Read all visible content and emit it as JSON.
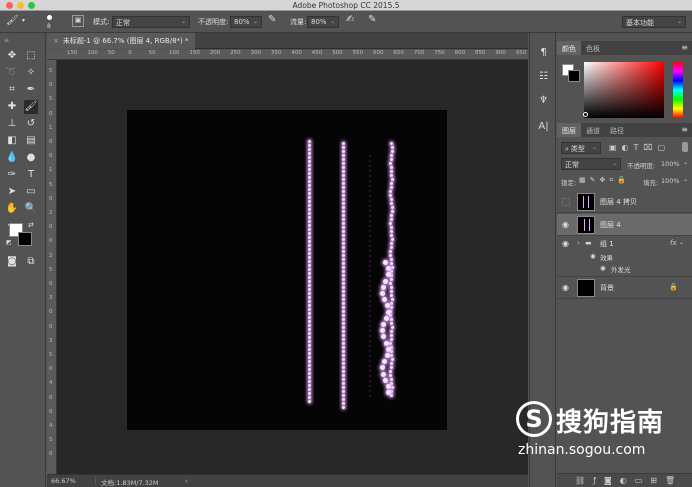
{
  "titlebar": {
    "title": "Adobe Photoshop CC 2015.5"
  },
  "options": {
    "brush_size": "8",
    "mode_label": "模式:",
    "mode_value": "正常",
    "opacity_label": "不透明度:",
    "opacity_value": "80%",
    "flow_label": "流量:",
    "flow_value": "80%",
    "workspace_value": "基本功能"
  },
  "document": {
    "tab_label": "未标题-1 @ 66.7% (图层 4, RGB/8*) *",
    "ruler_h": [
      "150",
      "100",
      "50",
      "0",
      "50",
      "100",
      "150",
      "200",
      "250",
      "300",
      "350",
      "400",
      "450",
      "500",
      "550",
      "600",
      "650",
      "700",
      "750",
      "800",
      "850",
      "900",
      "950"
    ],
    "ruler_v": [
      "5",
      "0",
      "5",
      "0",
      "1",
      "0",
      "0",
      "1",
      "5",
      "0",
      "2",
      "0",
      "0",
      "2",
      "5",
      "0",
      "3",
      "0",
      "0",
      "3",
      "5",
      "0",
      "4",
      "0",
      "0",
      "4",
      "5",
      "0"
    ]
  },
  "status": {
    "zoom": "66.67%",
    "doc_info": "文档:1.83M/7.32M"
  },
  "color_panel": {
    "tabs": [
      "颜色",
      "色板"
    ]
  },
  "layers_panel": {
    "tabs": [
      "图层",
      "通道",
      "路径"
    ],
    "filter_label": "类型",
    "blend_mode": "正常",
    "opacity_label": "不透明度:",
    "opacity_value": "100%",
    "lock_label": "锁定:",
    "fill_label": "填充:",
    "fill_value": "100%",
    "layers": [
      {
        "name": "图层 4 拷贝"
      },
      {
        "name": "图层 4"
      },
      {
        "name": "组 1"
      },
      {
        "name": "效果"
      },
      {
        "name": "外发光"
      },
      {
        "name": "背景"
      }
    ]
  },
  "watermark": {
    "brand": "搜狗指南",
    "url": "zhinan.sogou.com",
    "logo_letter": "S"
  },
  "colors": {
    "glow": "#e9a8ff",
    "bead": "#f6e6ff",
    "canvas": "#050505"
  }
}
